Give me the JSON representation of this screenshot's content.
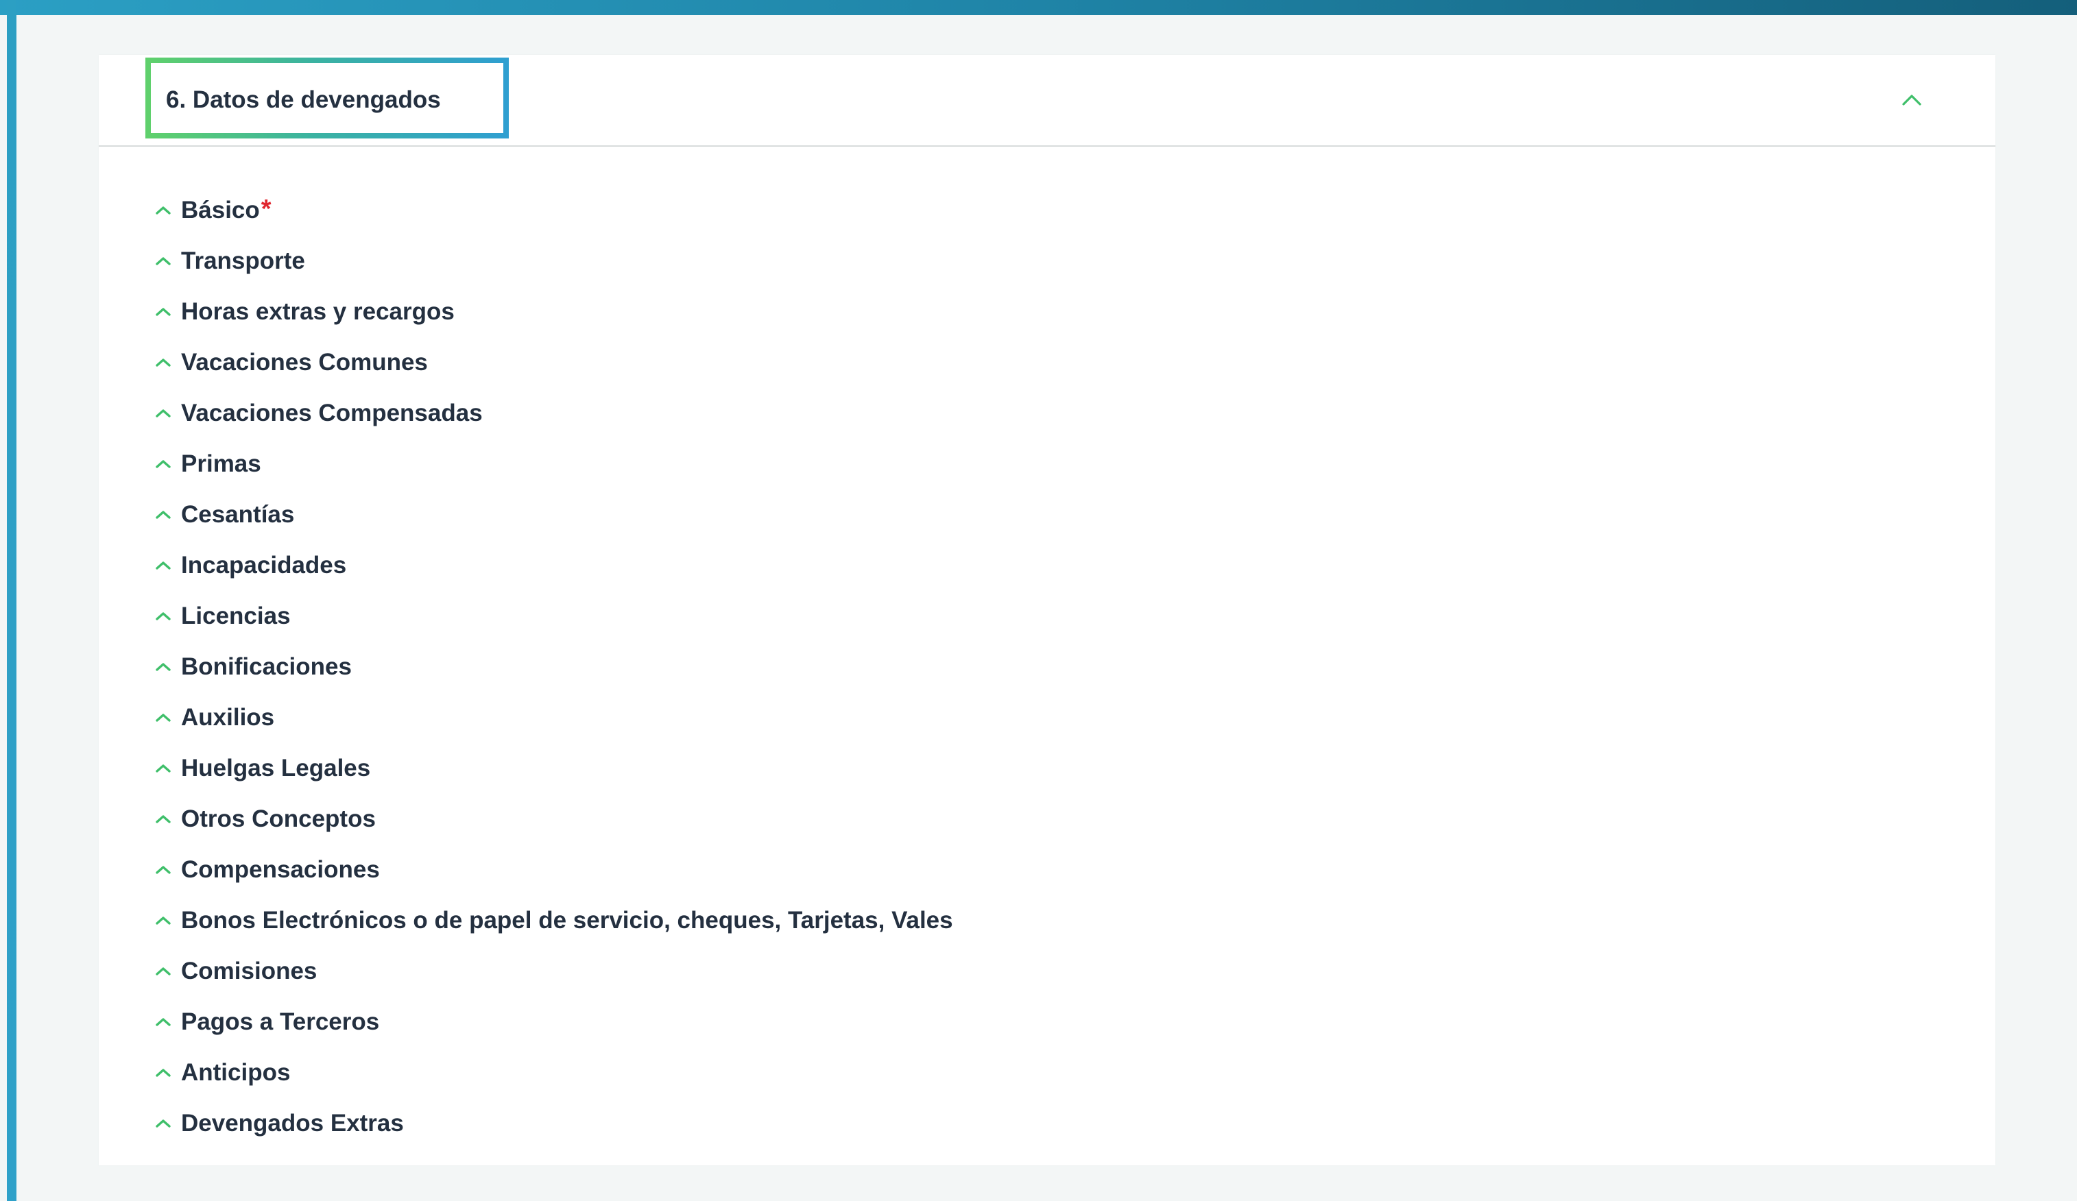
{
  "section": {
    "title": "6. Datos de devengados",
    "collapse_icon": "chevron-up-icon"
  },
  "colors": {
    "accent_green": "#3fbf6a",
    "accent_blue": "#2f9fd0",
    "required_red": "#e0262e",
    "text_dark": "#243040"
  },
  "items": [
    {
      "label": "Básico",
      "required_mark": "*",
      "icon": "chevron-up-icon"
    },
    {
      "label": "Transporte",
      "required_mark": "",
      "icon": "chevron-up-icon"
    },
    {
      "label": "Horas extras y recargos",
      "required_mark": "",
      "icon": "chevron-up-icon"
    },
    {
      "label": "Vacaciones Comunes",
      "required_mark": "",
      "icon": "chevron-up-icon"
    },
    {
      "label": "Vacaciones Compensadas",
      "required_mark": "",
      "icon": "chevron-up-icon"
    },
    {
      "label": "Primas",
      "required_mark": "",
      "icon": "chevron-up-icon"
    },
    {
      "label": "Cesantías",
      "required_mark": "",
      "icon": "chevron-up-icon"
    },
    {
      "label": "Incapacidades",
      "required_mark": "",
      "icon": "chevron-up-icon"
    },
    {
      "label": "Licencias",
      "required_mark": "",
      "icon": "chevron-up-icon"
    },
    {
      "label": "Bonificaciones",
      "required_mark": "",
      "icon": "chevron-up-icon"
    },
    {
      "label": "Auxilios",
      "required_mark": "",
      "icon": "chevron-up-icon"
    },
    {
      "label": "Huelgas Legales",
      "required_mark": "",
      "icon": "chevron-up-icon"
    },
    {
      "label": "Otros Conceptos",
      "required_mark": "",
      "icon": "chevron-up-icon"
    },
    {
      "label": "Compensaciones",
      "required_mark": "",
      "icon": "chevron-up-icon"
    },
    {
      "label": "Bonos Electrónicos o de papel de servicio, cheques, Tarjetas, Vales",
      "required_mark": "",
      "icon": "chevron-up-icon"
    },
    {
      "label": "Comisiones",
      "required_mark": "",
      "icon": "chevron-up-icon"
    },
    {
      "label": "Pagos a Terceros",
      "required_mark": "",
      "icon": "chevron-up-icon"
    },
    {
      "label": "Anticipos",
      "required_mark": "",
      "icon": "chevron-up-icon"
    },
    {
      "label": "Devengados Extras",
      "required_mark": "",
      "icon": "chevron-up-icon"
    }
  ]
}
